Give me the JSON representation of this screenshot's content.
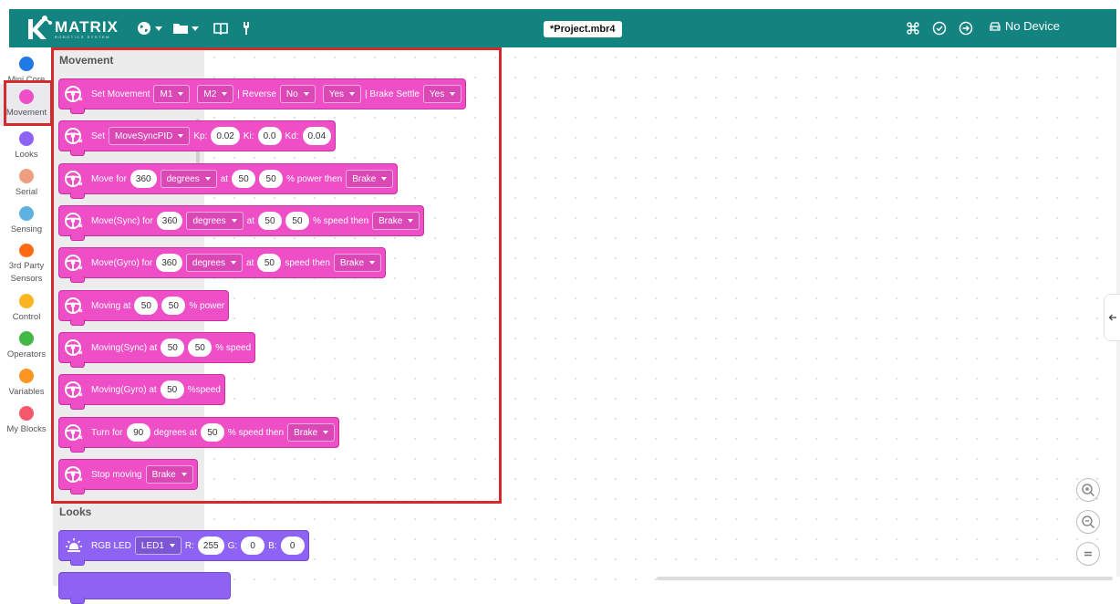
{
  "header": {
    "logo_title": "MATRIX",
    "logo_subtitle": "ROBOTICS SYSTEM",
    "project_title": "*Project.mbr4",
    "device_status": "No Device",
    "icons": [
      "globe-icon",
      "folder-icon",
      "book-icon",
      "tool-icon",
      "command-icon",
      "check-circle-icon",
      "arrow-circle-right-icon",
      "car-icon"
    ]
  },
  "sidebar": {
    "items": [
      {
        "label": "Mini Core",
        "color": "#1f7ae6"
      },
      {
        "label": "Movement",
        "color": "#ee4fc6"
      },
      {
        "label": "Looks",
        "color": "#8e62f2"
      },
      {
        "label": "Serial",
        "color": "#ef9f7f"
      },
      {
        "label": "Sensing",
        "color": "#5db2e0"
      },
      {
        "label": "3rd Party",
        "label2": "Sensors",
        "color": "#ff6a14"
      },
      {
        "label": "Control",
        "color": "#fcb521"
      },
      {
        "label": "Operators",
        "color": "#43b845"
      },
      {
        "label": "Variables",
        "color": "#fb9523"
      },
      {
        "label": "My Blocks",
        "color": "#f4586a"
      }
    ],
    "selected": "Movement"
  },
  "flyout": {
    "movement_title": "Movement",
    "looks_title": "Looks",
    "blocks": {
      "b1": {
        "t1": "Set Movement",
        "d1": "M1",
        "d2": "M2",
        "t2": "| Reverse",
        "d3": "No",
        "d4": "Yes",
        "t3": "| Brake Settle",
        "d5": "Yes"
      },
      "b2": {
        "t1": "Set",
        "d1": "MoveSyncPID",
        "t2": "Kp:",
        "n1": "0.02",
        "t3": "Ki:",
        "n2": "0.0",
        "t4": "Kd:",
        "n3": "0.04"
      },
      "b3": {
        "t1": "Move for",
        "n1": "360",
        "d1": "degrees",
        "t2": "at",
        "n2": "50",
        "n3": "50",
        "t3": "% power then",
        "d2": "Brake"
      },
      "b4": {
        "t1": "Move(Sync) for",
        "n1": "360",
        "d1": "degrees",
        "t2": "at",
        "n2": "50",
        "n3": "50",
        "t3": "% speed then",
        "d2": "Brake"
      },
      "b5": {
        "t1": "Move(Gyro) for",
        "n1": "360",
        "d1": "degrees",
        "t2": "at",
        "n2": "50",
        "t3": "speed then",
        "d2": "Brake"
      },
      "b6": {
        "t1": "Moving at",
        "n1": "50",
        "n2": "50",
        "t2": "% power"
      },
      "b7": {
        "t1": "Moving(Sync) at",
        "n1": "50",
        "n2": "50",
        "t2": "% speed"
      },
      "b8": {
        "t1": "Moving(Gyro) at",
        "n1": "50",
        "t2": "%speed"
      },
      "b9": {
        "t1": "Turn for",
        "n1": "90",
        "t2": "degrees at",
        "n2": "50",
        "t3": "% speed then",
        "d1": "Brake"
      },
      "b10": {
        "t1": "Stop moving",
        "d1": "Brake"
      },
      "b11": {
        "t1": "RGB LED",
        "d1": "LED1",
        "t2": "R:",
        "n1": "255",
        "t3": "G:",
        "n2": "0",
        "t4": "B:",
        "n3": "0"
      }
    }
  },
  "colors": {
    "header": "#12837f",
    "movement": "#ee4fc6",
    "looks": "#8e62f2",
    "highlight": "#d32b2b"
  }
}
